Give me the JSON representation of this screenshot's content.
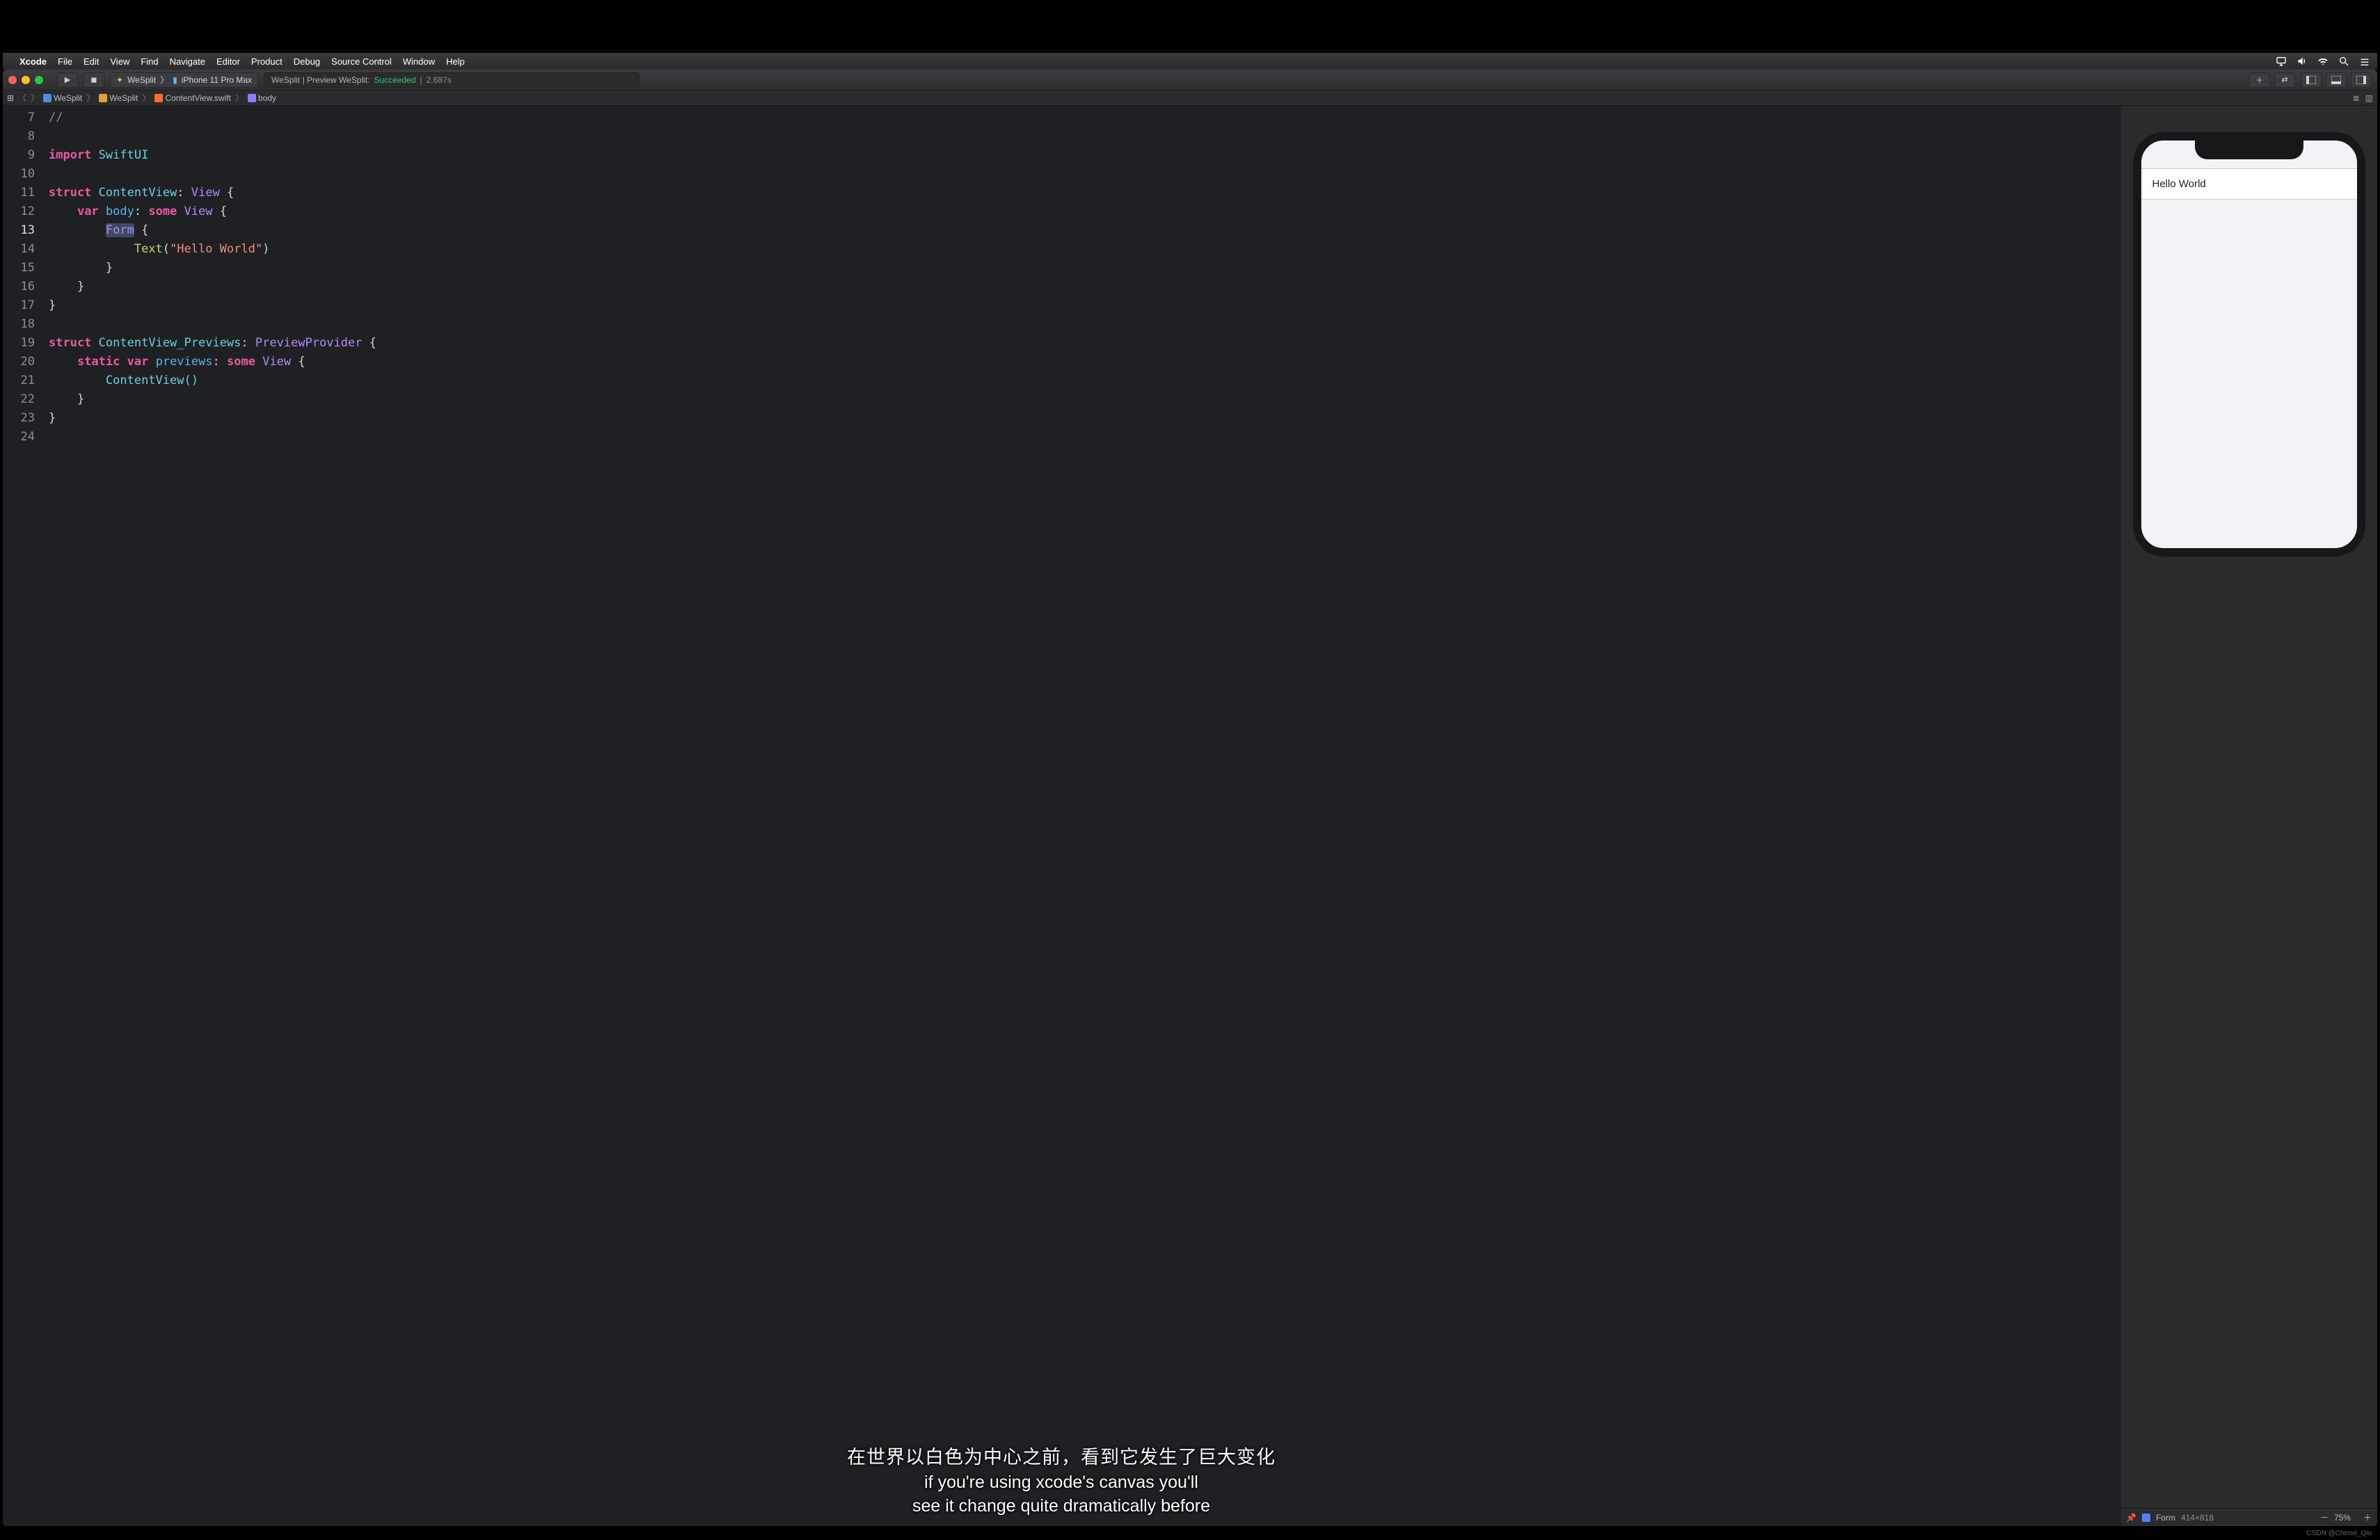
{
  "menubar": {
    "app": "Xcode",
    "items": [
      "File",
      "Edit",
      "View",
      "Find",
      "Navigate",
      "Editor",
      "Product",
      "Debug",
      "Source Control",
      "Window",
      "Help"
    ]
  },
  "toolbar": {
    "scheme_project": "WeSplit",
    "scheme_device": "iPhone 11 Pro Max",
    "activity_prefix": "WeSplit | Preview WeSplit:",
    "activity_status": "Succeeded",
    "activity_time": "2.687s"
  },
  "jumpbar": {
    "project": "WeSplit",
    "folder": "WeSplit",
    "file": "ContentView.swift",
    "symbol": "body"
  },
  "editor": {
    "line_start": 7,
    "line_end": 24,
    "current_line": 13,
    "string_literal": "\"Hello World\"",
    "tokens": {
      "import": "import",
      "SwiftUI": "SwiftUI",
      "struct": "struct",
      "ContentView": "ContentView",
      "View": "View",
      "var": "var",
      "body": "body",
      "some": "some",
      "Form": "Form",
      "Text": "Text",
      "ContentView_Previews": "ContentView_Previews",
      "PreviewProvider": "PreviewProvider",
      "static": "static",
      "previews": "previews",
      "ContentViewCall": "ContentView()"
    }
  },
  "preview": {
    "cell_text": "Hello World",
    "footer_label": "Form",
    "footer_size": "414×818",
    "zoom": "75%"
  },
  "subtitle": {
    "cn": "在世界以白色为中心之前，看到它发生了巨大变化",
    "en1": "if you're using xcode's canvas you'll",
    "en2": "see it change quite dramatically before"
  },
  "watermark": "CSDN @Chenxi_Qiu"
}
